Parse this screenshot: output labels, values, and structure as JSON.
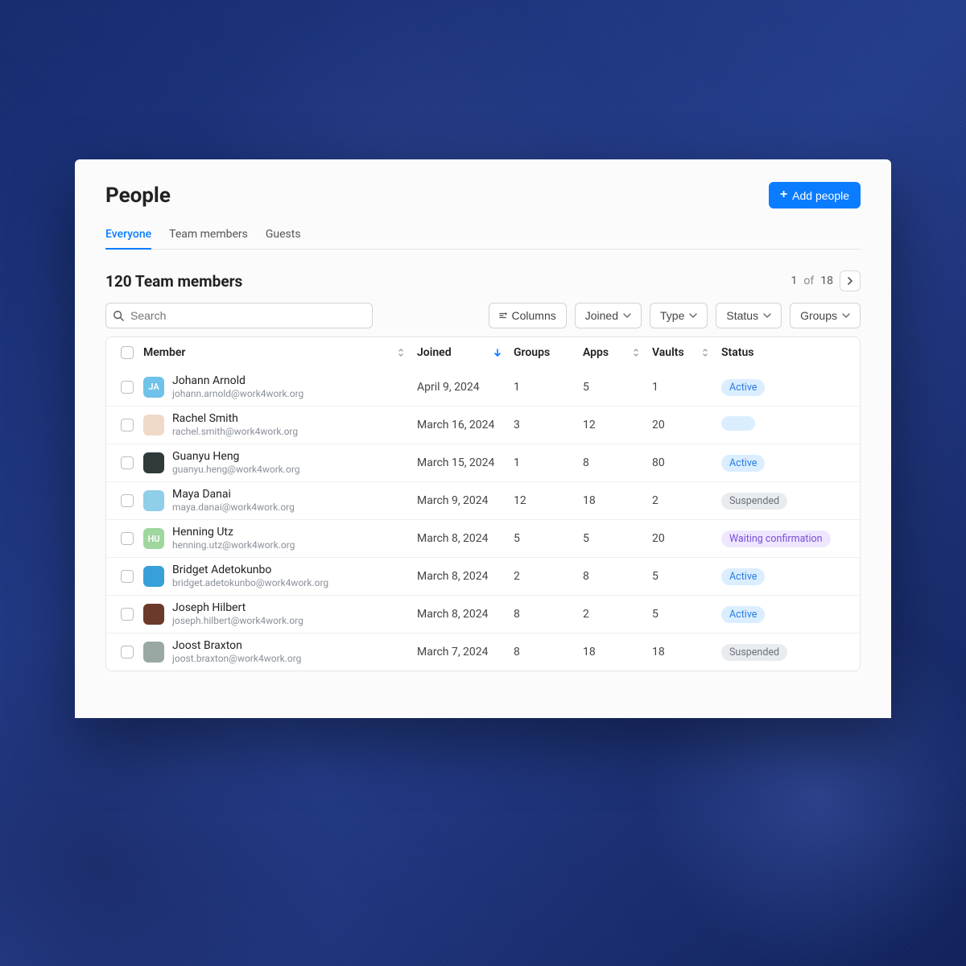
{
  "header": {
    "title": "People",
    "add_button": "Add people"
  },
  "tabs": [
    "Everyone",
    "Team members",
    "Guests"
  ],
  "active_tab": 0,
  "subheader": {
    "count_label": "120 Team members",
    "page_current": "1",
    "page_of": "of",
    "page_total": "18"
  },
  "search": {
    "placeholder": "Search"
  },
  "filters": {
    "columns": "Columns",
    "joined": "Joined",
    "type": "Type",
    "status": "Status",
    "groups": "Groups"
  },
  "columns": {
    "member": "Member",
    "joined": "Joined",
    "groups": "Groups",
    "apps": "Apps",
    "vaults": "Vaults",
    "status": "Status"
  },
  "status_labels": {
    "active": "Active",
    "suspended": "Suspended",
    "waiting": "Waiting confirmation"
  },
  "rows": [
    {
      "initials": "JA",
      "avatar_bg": "#6fc2e8",
      "name": "Johann Arnold",
      "email": "johann.arnold@work4work.org",
      "joined": "April 9, 2024",
      "groups": "1",
      "apps": "5",
      "vaults": "1",
      "status": "active"
    },
    {
      "initials": "",
      "avatar_bg": "#f1d9c8",
      "name": "Rachel Smith",
      "email": "rachel.smith@work4work.org",
      "joined": "March 16, 2024",
      "groups": "3",
      "apps": "12",
      "vaults": "20",
      "status": "blank"
    },
    {
      "initials": "",
      "avatar_bg": "#2f3a3a",
      "name": "Guanyu Heng",
      "email": "guanyu.heng@work4work.org",
      "joined": "March 15, 2024",
      "groups": "1",
      "apps": "8",
      "vaults": "80",
      "status": "active"
    },
    {
      "initials": "",
      "avatar_bg": "#8fcfe8",
      "name": "Maya Danai",
      "email": "maya.danai@work4work.org",
      "joined": "March 9, 2024",
      "groups": "12",
      "apps": "18",
      "vaults": "2",
      "status": "suspended"
    },
    {
      "initials": "HU",
      "avatar_bg": "#9fd79f",
      "name": "Henning Utz",
      "email": "henning.utz@work4work.org",
      "joined": "March 8, 2024",
      "groups": "5",
      "apps": "5",
      "vaults": "20",
      "status": "waiting"
    },
    {
      "initials": "",
      "avatar_bg": "#38a0d8",
      "name": "Bridget Adetokunbo",
      "email": "bridget.adetokunbo@work4work.org",
      "joined": "March 8, 2024",
      "groups": "2",
      "apps": "8",
      "vaults": "5",
      "status": "active"
    },
    {
      "initials": "",
      "avatar_bg": "#6b3a2a",
      "name": "Joseph Hilbert",
      "email": "joseph.hilbert@work4work.org",
      "joined": "March 8, 2024",
      "groups": "8",
      "apps": "2",
      "vaults": "5",
      "status": "active"
    },
    {
      "initials": "",
      "avatar_bg": "#9aa8a3",
      "name": "Joost Braxton",
      "email": "joost.braxton@work4work.org",
      "joined": "March 7, 2024",
      "groups": "8",
      "apps": "18",
      "vaults": "18",
      "status": "suspended"
    }
  ]
}
